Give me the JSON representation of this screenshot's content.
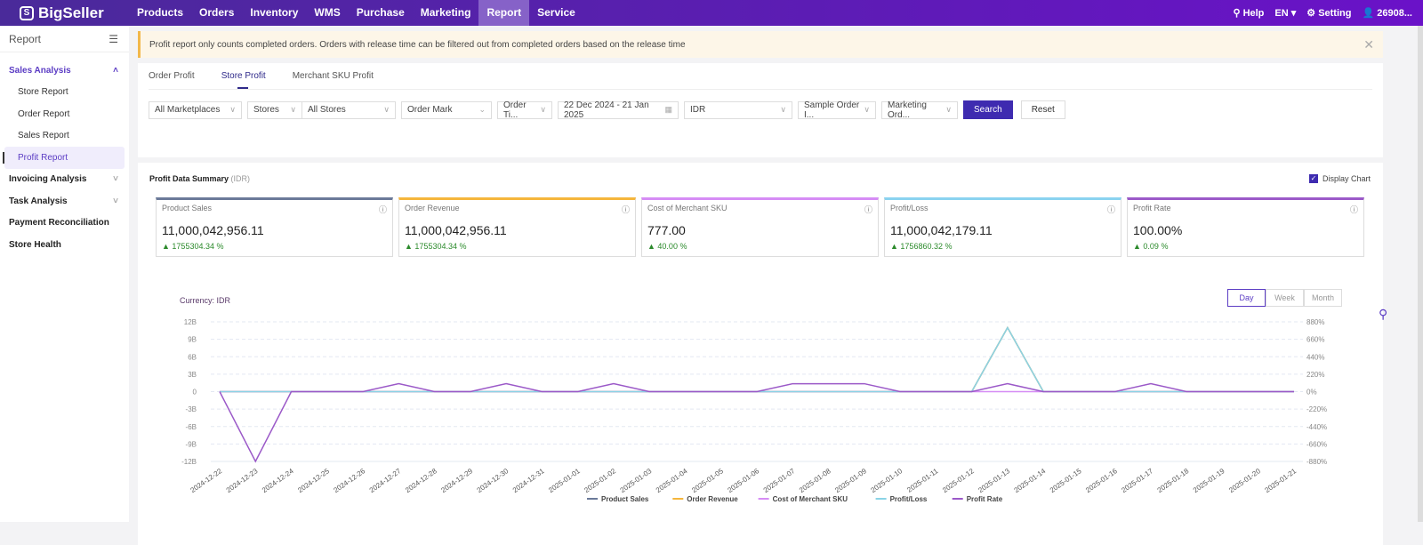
{
  "header": {
    "logo": "BigSeller",
    "nav": [
      "Products",
      "Orders",
      "Inventory",
      "WMS",
      "Purchase",
      "Marketing",
      "Report",
      "Service"
    ],
    "active": "Report",
    "help": "Help",
    "lang": "EN",
    "setting": "Setting",
    "user": "26908..."
  },
  "sidebar": {
    "title": "Report",
    "groups": [
      {
        "label": "Sales Analysis",
        "expanded": true,
        "items": [
          "Store Report",
          "Order Report",
          "Sales Report",
          "Profit Report"
        ]
      },
      {
        "label": "Invoicing Analysis"
      },
      {
        "label": "Task Analysis"
      },
      {
        "label": "Payment Reconciliation"
      },
      {
        "label": "Store Health"
      }
    ],
    "active": "Profit Report"
  },
  "notice": "Profit report only counts completed orders. Orders with release time can be filtered out from completed orders based on the release time",
  "tabs": [
    "Order Profit",
    "Store Profit",
    "Merchant SKU Profit"
  ],
  "filters": {
    "marketplace": "All Marketplaces",
    "stores_type": "Stores",
    "stores": "All Stores",
    "order_mark": "Order Mark",
    "order_time": "Order Ti...",
    "date_start": "22 Dec 2024",
    "date_end": "21 Jan 2025",
    "currency": "IDR",
    "sample": "Sample Order I...",
    "marketing": "Marketing Ord...",
    "search": "Search",
    "reset": "Reset"
  },
  "summary": {
    "title": "Profit Data Summary",
    "unit": "(IDR)",
    "display_chart": "Display Chart",
    "display_chart_checked": true,
    "cards": [
      {
        "label": "Product Sales",
        "value": "11,000,042,956.11",
        "change": "1755304.34 %",
        "color": "#6b7a99"
      },
      {
        "label": "Order Revenue",
        "value": "11,000,042,956.11",
        "change": "1755304.34 %",
        "color": "#f5b63c"
      },
      {
        "label": "Cost of Merchant SKU",
        "value": "777.00",
        "change": "40.00 %",
        "color": "#d68cf5"
      },
      {
        "label": "Profit/Loss",
        "value": "11,000,042,179.11",
        "change": "1756860.32 %",
        "color": "#8ad3f0"
      },
      {
        "label": "Profit Rate",
        "value": "100.00%",
        "change": "0.09 %",
        "color": "#9b59c8"
      }
    ]
  },
  "chart_controls": {
    "currency": "Currency:  IDR",
    "periods": [
      "Day",
      "Week",
      "Month"
    ],
    "active": "Day"
  },
  "chart_data": {
    "type": "line",
    "x": [
      "2024-12-22",
      "2024-12-23",
      "2024-12-24",
      "2024-12-25",
      "2024-12-26",
      "2024-12-27",
      "2024-12-28",
      "2024-12-29",
      "2024-12-30",
      "2024-12-31",
      "2025-01-01",
      "2025-01-02",
      "2025-01-03",
      "2025-01-04",
      "2025-01-05",
      "2025-01-06",
      "2025-01-07",
      "2025-01-08",
      "2025-01-09",
      "2025-01-10",
      "2025-01-11",
      "2025-01-12",
      "2025-01-13",
      "2025-01-14",
      "2025-01-15",
      "2025-01-16",
      "2025-01-17",
      "2025-01-18",
      "2025-01-19",
      "2025-01-20",
      "2025-01-21"
    ],
    "y_left": {
      "ticks": [
        "12B",
        "9B",
        "6B",
        "3B",
        "0",
        "-3B",
        "-6B",
        "-9B",
        "-12B"
      ],
      "range": [
        -12,
        12
      ],
      "unit": "B"
    },
    "y_right": {
      "ticks": [
        "880%",
        "660%",
        "440%",
        "220%",
        "0%",
        "-220%",
        "-440%",
        "-660%",
        "-880%"
      ],
      "range": [
        -880,
        880
      ]
    },
    "grid": true,
    "legend": "bottom",
    "series": [
      {
        "name": "Product Sales",
        "axis": "left",
        "color": "#6b7a99",
        "values": [
          0,
          0,
          0,
          0,
          0,
          0,
          0,
          0,
          0,
          0,
          0,
          0,
          0,
          0,
          0,
          0,
          0,
          0,
          0,
          0,
          0,
          0,
          11,
          0,
          0,
          0,
          0,
          0,
          0,
          0,
          0
        ]
      },
      {
        "name": "Order Revenue",
        "axis": "left",
        "color": "#f5b63c",
        "values": [
          0,
          0,
          0,
          0,
          0,
          0,
          0,
          0,
          0,
          0,
          0,
          0,
          0,
          0,
          0,
          0,
          0,
          0,
          0,
          0,
          0,
          0,
          11,
          0,
          0,
          0,
          0,
          0,
          0,
          0,
          0
        ]
      },
      {
        "name": "Cost of Merchant SKU",
        "axis": "left",
        "color": "#d68cf5",
        "values": [
          0,
          0,
          0,
          0,
          0,
          0,
          0,
          0,
          0,
          0,
          0,
          0,
          0,
          0,
          0,
          0,
          0,
          0,
          0,
          0,
          0,
          0,
          0,
          0,
          0,
          0,
          0,
          0,
          0,
          0,
          0
        ]
      },
      {
        "name": "Profit/Loss",
        "axis": "left",
        "color": "#8ad3e6",
        "values": [
          0,
          0,
          0,
          0,
          0,
          0,
          0,
          0,
          0,
          0,
          0,
          0,
          0,
          0,
          0,
          0,
          0,
          0,
          0,
          0,
          0,
          0,
          11,
          0,
          0,
          0,
          0,
          0,
          0,
          0,
          0
        ]
      },
      {
        "name": "Profit Rate",
        "axis": "right",
        "color": "#9b59c8",
        "values": [
          0,
          -880,
          0,
          0,
          0,
          100,
          0,
          0,
          100,
          0,
          0,
          100,
          0,
          0,
          0,
          0,
          100,
          100,
          100,
          0,
          0,
          0,
          100,
          0,
          0,
          0,
          100,
          0,
          0,
          0,
          0
        ]
      }
    ]
  }
}
